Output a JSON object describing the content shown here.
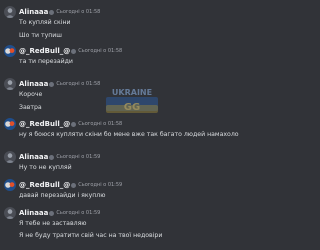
{
  "colors": {
    "background": "#313338",
    "author_text": "#f2f3f5",
    "message_text": "#dbdee1",
    "timestamp_text": "#a0a3aa"
  },
  "watermark": {
    "line1": "UKRAINE",
    "line2": "GG"
  },
  "messages": [
    {
      "author": "Alinaaa",
      "avatar": "avatar-alinaaa",
      "timestamp": "Сьогодні о 01:58",
      "lines": [
        "То купляй скіни",
        "Шо ти тупиш"
      ]
    },
    {
      "author": "@_RedBull_@",
      "avatar": "avatar-redbull",
      "timestamp": "Сьогодні о 01:58",
      "lines": [
        "та ти перезайди"
      ]
    },
    {
      "author": "Alinaaa",
      "avatar": "avatar-alinaaa",
      "timestamp": "Сьогодні о 01:58",
      "lines": [
        "Короче",
        "Завтра"
      ]
    },
    {
      "author": "@_RedBull_@",
      "avatar": "avatar-redbull",
      "timestamp": "Сьогодні о 01:58",
      "lines": [
        "ну я боюся купляти скіни бо мене вже так багато людей намахоло"
      ]
    },
    {
      "author": "Alinaaa",
      "avatar": "avatar-alinaaa",
      "timestamp": "Сьогодні о 01:59",
      "lines": [
        "Ну то не купляй"
      ]
    },
    {
      "author": "@_RedBull_@",
      "avatar": "avatar-redbull",
      "timestamp": "Сьогодні о 01:59",
      "lines": [
        "давай перезайди і якуплю"
      ]
    },
    {
      "author": "Alinaaa",
      "avatar": "avatar-alinaaa",
      "timestamp": "Сьогодні о 01:59",
      "lines": [
        "Я тебе не заставляю",
        "Я не буду тратити свій час на твої недовіри"
      ]
    }
  ]
}
